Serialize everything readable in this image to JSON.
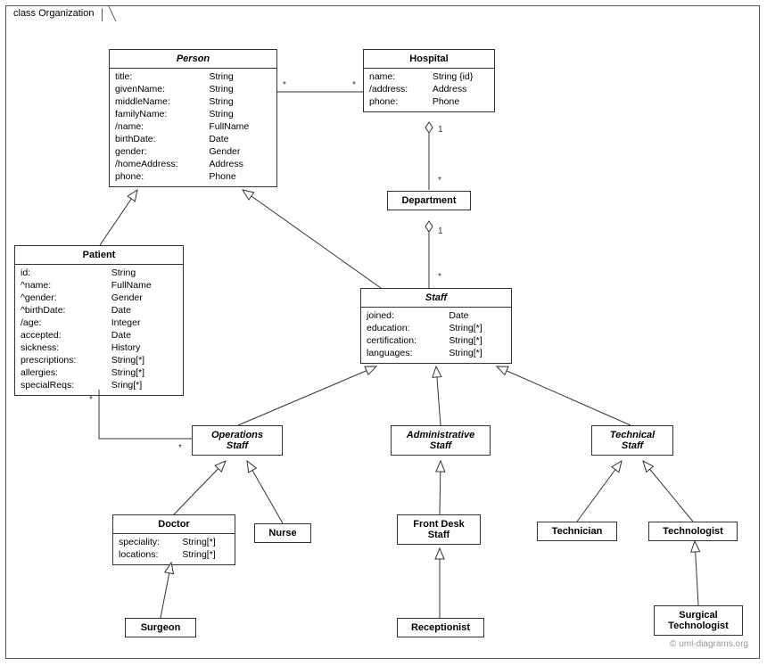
{
  "frame": {
    "title": "class Organization"
  },
  "classes": {
    "person": {
      "name": "Person",
      "attrs": [
        [
          "title:",
          "String"
        ],
        [
          "givenName:",
          "String"
        ],
        [
          "middleName:",
          "String"
        ],
        [
          "familyName:",
          "String"
        ],
        [
          "/name:",
          "FullName"
        ],
        [
          "birthDate:",
          "Date"
        ],
        [
          "gender:",
          "Gender"
        ],
        [
          "/homeAddress:",
          "Address"
        ],
        [
          "phone:",
          "Phone"
        ]
      ]
    },
    "hospital": {
      "name": "Hospital",
      "attrs": [
        [
          "name:",
          "String {id}"
        ],
        [
          "/address:",
          "Address"
        ],
        [
          "phone:",
          "Phone"
        ]
      ]
    },
    "department": {
      "name": "Department"
    },
    "patient": {
      "name": "Patient",
      "attrs": [
        [
          "id:",
          "String"
        ],
        [
          "^name:",
          "FullName"
        ],
        [
          "^gender:",
          "Gender"
        ],
        [
          "^birthDate:",
          "Date"
        ],
        [
          "/age:",
          "Integer"
        ],
        [
          "accepted:",
          "Date"
        ],
        [
          "sickness:",
          "History"
        ],
        [
          "prescriptions:",
          "String[*]"
        ],
        [
          "allergies:",
          "String[*]"
        ],
        [
          "specialReqs:",
          "Sring[*]"
        ]
      ]
    },
    "staff": {
      "name": "Staff",
      "attrs": [
        [
          "joined:",
          "Date"
        ],
        [
          "education:",
          "String[*]"
        ],
        [
          "certification:",
          "String[*]"
        ],
        [
          "languages:",
          "String[*]"
        ]
      ]
    },
    "opsStaff": {
      "name1": "Operations",
      "name2": "Staff"
    },
    "adminStaff": {
      "name1": "Administrative",
      "name2": "Staff"
    },
    "techStaff": {
      "name1": "Technical",
      "name2": "Staff"
    },
    "doctor": {
      "name": "Doctor",
      "attrs": [
        [
          "speciality:",
          "String[*]"
        ],
        [
          "locations:",
          "String[*]"
        ]
      ]
    },
    "nurse": {
      "name": "Nurse"
    },
    "frontDesk": {
      "name1": "Front Desk",
      "name2": "Staff"
    },
    "technician": {
      "name": "Technician"
    },
    "technologist": {
      "name": "Technologist"
    },
    "surgeon": {
      "name": "Surgeon"
    },
    "receptionist": {
      "name": "Receptionist"
    },
    "surgTech": {
      "name1": "Surgical",
      "name2": "Technologist"
    }
  },
  "multiplicities": {
    "hospDept1": "1",
    "hospDeptStar": "*",
    "deptStaff1": "1",
    "deptStaffStar": "*",
    "personHospStarL": "*",
    "personHospStarR": "*",
    "patientOpsStarT": "*",
    "patientOpsStarB": "*"
  },
  "copyright": "© uml-diagrams.org"
}
